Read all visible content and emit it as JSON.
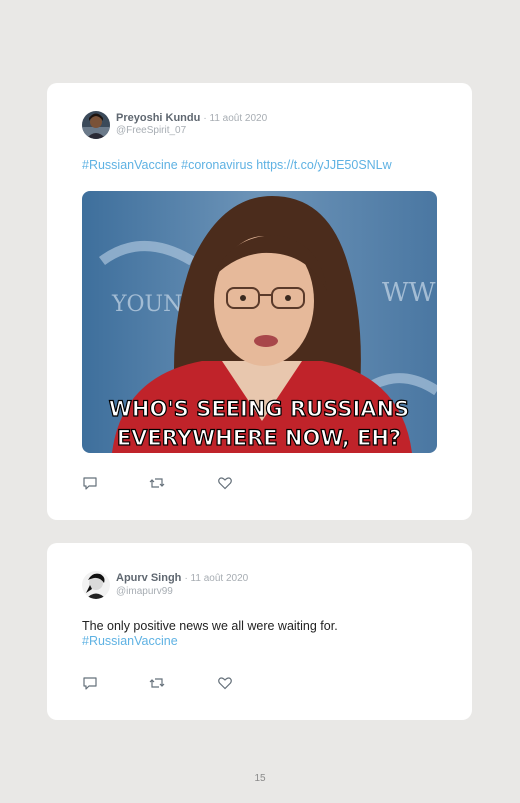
{
  "tweets": [
    {
      "author": "Preyoshi Kundu",
      "date": "· 11 août 2020",
      "handle": "@FreeSpirit_07",
      "hashtags": "#RussianVaccine #coronavirus",
      "link": "https://t.co/yJJE50SNLw",
      "image_caption_line1": "WHO'S SEEING RUSSIANS",
      "image_caption_line2": "EVERYWHERE NOW, EH?",
      "image_sign_text": "YOUNG",
      "image_sign_text_right": "WW"
    },
    {
      "author": "Apurv Singh",
      "date": "· 11 août 2020",
      "handle": "@imapurv99",
      "text": "The only positive news we all were waiting for.",
      "hashtag": "#RussianVaccine"
    }
  ],
  "icons": {
    "reply": "reply-icon",
    "retweet": "retweet-icon",
    "like": "heart-icon"
  },
  "colors": {
    "link": "#5fb2e3",
    "card": "#ffffff",
    "background": "#e9e8e6"
  },
  "page_number": "15"
}
